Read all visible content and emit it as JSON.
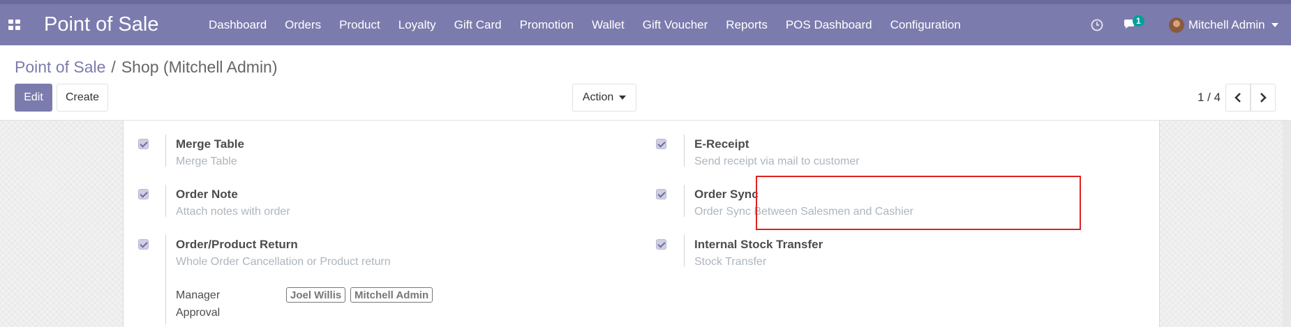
{
  "navbar": {
    "brand": "Point of Sale",
    "menu": [
      "Dashboard",
      "Orders",
      "Product",
      "Loyalty",
      "Gift Card",
      "Promotion",
      "Wallet",
      "Gift Voucher",
      "Reports",
      "POS Dashboard",
      "Configuration"
    ],
    "chat_count": "1",
    "user_name": "Mitchell Admin",
    "color": "#7c7bad"
  },
  "breadcrumb": {
    "parent": "Point of Sale",
    "separator": "/",
    "current": "Shop (Mitchell Admin)"
  },
  "buttons": {
    "edit": "Edit",
    "create": "Create",
    "action": "Action"
  },
  "pager": {
    "value": "1 / 4"
  },
  "settings": {
    "merge_table": {
      "title": "Merge Table",
      "desc": "Merge Table",
      "checked": true
    },
    "e_receipt": {
      "title": "E-Receipt",
      "desc": "Send receipt via mail to customer",
      "checked": true
    },
    "order_note": {
      "title": "Order Note",
      "desc": "Attach notes with order",
      "checked": true
    },
    "order_sync": {
      "title": "Order Sync",
      "desc": "Order Sync Between Salesmen and Cashier",
      "checked": true,
      "highlighted": true
    },
    "order_return": {
      "title": "Order/Product Return",
      "desc": "Whole Order Cancellation or Product return",
      "checked": true
    },
    "stock_transfer": {
      "title": "Internal Stock Transfer",
      "desc": "Stock Transfer",
      "checked": true
    }
  },
  "manager_approval": {
    "label_line1": "Manager",
    "label_line2": "Approval",
    "tags": [
      "Joel Willis",
      "Mitchell Admin"
    ]
  }
}
